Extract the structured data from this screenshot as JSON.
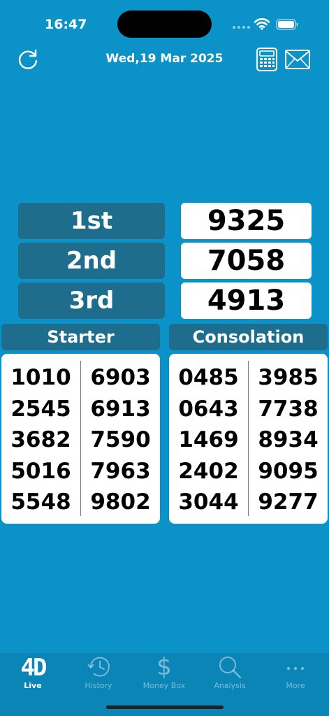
{
  "status_bar": {
    "time": "16:47"
  },
  "header": {
    "date": "Wed,19 Mar 2025"
  },
  "prizes": [
    {
      "label": "1st",
      "number": "9325"
    },
    {
      "label": "2nd",
      "number": "7058"
    },
    {
      "label": "3rd",
      "number": "4913"
    }
  ],
  "starter": {
    "title": "Starter",
    "left": [
      "1010",
      "2545",
      "3682",
      "5016",
      "5548"
    ],
    "right": [
      "6903",
      "6913",
      "7590",
      "7963",
      "9802"
    ]
  },
  "consolation": {
    "title": "Consolation",
    "left": [
      "0485",
      "0643",
      "1469",
      "2402",
      "3044"
    ],
    "right": [
      "3985",
      "7738",
      "8934",
      "9095",
      "9277"
    ]
  },
  "tabs": [
    {
      "label": "Live",
      "icon": "4D"
    },
    {
      "label": "History",
      "icon": "history-icon"
    },
    {
      "label": "Money Box",
      "icon": "$"
    },
    {
      "label": "Analysis",
      "icon": "search-icon"
    },
    {
      "label": "More",
      "icon": "more-icon"
    }
  ],
  "colors": {
    "background": "#0b93c9",
    "label_bg": "#1e6d8c",
    "tab_bar": "#0a85b6"
  }
}
